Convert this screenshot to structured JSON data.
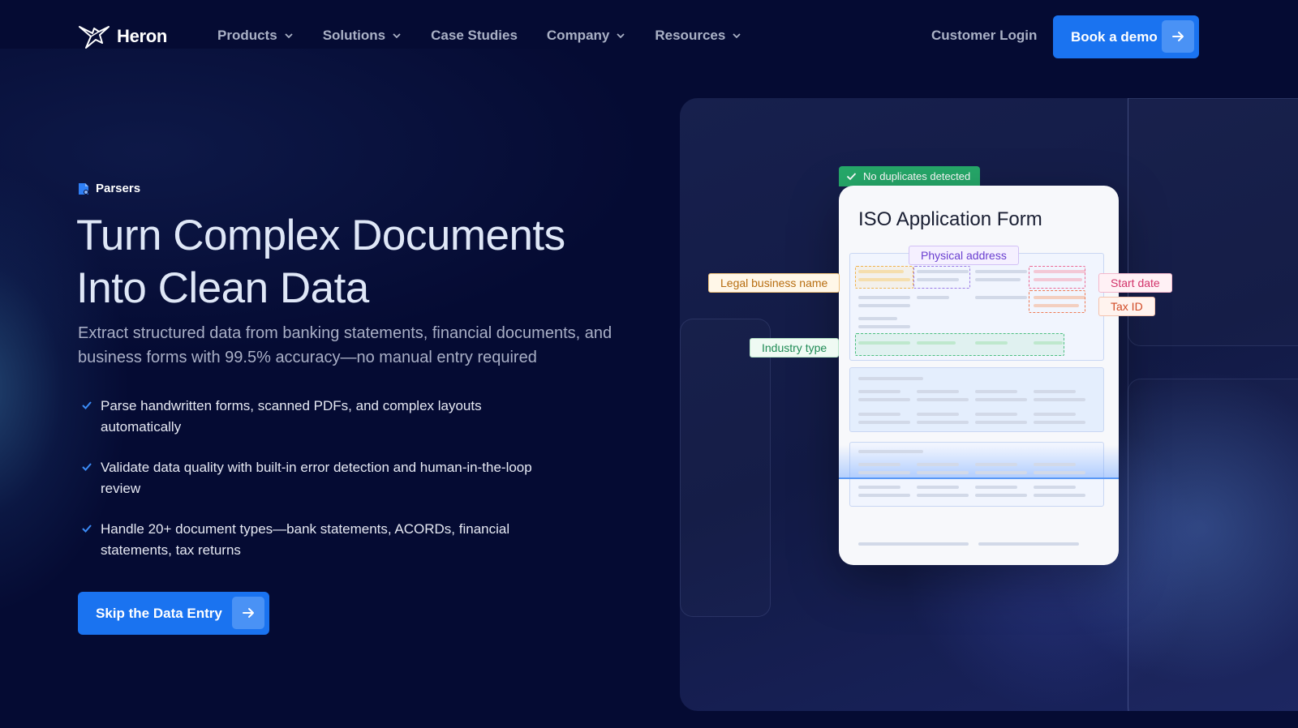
{
  "brand": {
    "name": "Heron"
  },
  "nav": {
    "links": [
      {
        "label": "Products",
        "has_menu": true
      },
      {
        "label": "Solutions",
        "has_menu": true
      },
      {
        "label": "Case Studies",
        "has_menu": false
      },
      {
        "label": "Company",
        "has_menu": true
      },
      {
        "label": "Resources",
        "has_menu": true
      }
    ],
    "customer_login": "Customer Login",
    "demo_button": "Book a demo"
  },
  "hero": {
    "eyebrow": "Parsers",
    "headline_line1": "Turn Complex Documents",
    "headline_line2": "Into Clean Data",
    "subtext": "Extract structured data from banking statements, financial documents, and business forms with 99.5% accuracy—no manual entry required",
    "bullets": [
      "Parse handwritten forms, scanned PDFs, and complex layouts automatically",
      "Validate data quality with built-in error detection and human-in-the-loop review",
      "Handle 20+ document types—bank statements, ACORDs, financial statements, tax returns"
    ],
    "cta": "Skip the Data Entry"
  },
  "illustration": {
    "badge": "No duplicates detected",
    "doc_title": "ISO Application Form",
    "tags": {
      "legal": "Legal business name",
      "physical": "Physical address",
      "start": "Start date",
      "tax": "Tax ID",
      "industry": "Industry type"
    }
  },
  "colors": {
    "background": "#050b33",
    "accent": "#1a73f0",
    "success": "#26a96a"
  }
}
